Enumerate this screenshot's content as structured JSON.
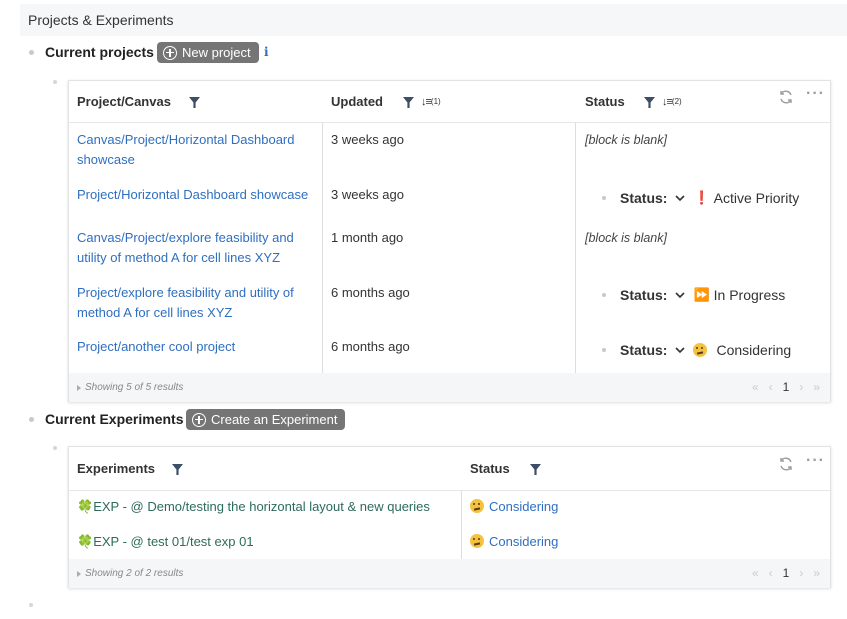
{
  "header": {
    "title": "Projects & Experiments"
  },
  "projects": {
    "title": "Current projects",
    "new_button": "New project",
    "info_icon": "i",
    "columns": [
      "Project/Canvas",
      "Updated",
      "Status"
    ],
    "sort_badges": {
      "updated": "(1)",
      "status": "(2)"
    },
    "rows": [
      {
        "project": [
          "Canvas/Project/Horizontal Dashboard",
          "showcase"
        ],
        "updated": "3 weeks ago",
        "blank": "[block is blank]"
      },
      {
        "project": [
          "Project/Horizontal Dashboard showcase"
        ],
        "updated": "3 weeks ago",
        "status_label": "Status:",
        "status_emoji": "❗",
        "status_value": "Active Priority"
      },
      {
        "project": [
          "Canvas/Project/explore feasibility and",
          "utility of method A for cell lines XYZ"
        ],
        "updated": "1 month ago",
        "blank": "[block is blank]"
      },
      {
        "project": [
          "Project/explore feasibility and utility of",
          "method A for cell lines XYZ"
        ],
        "updated": "6 months ago",
        "status_label": "Status:",
        "status_emoji": "⏩",
        "status_value": "In Progress"
      },
      {
        "project": [
          "Project/another cool project"
        ],
        "updated": "6 months ago",
        "status_label": "Status:",
        "status_emoji": "🤔",
        "status_value": "Considering"
      }
    ],
    "footer": "Showing 5 of 5 results",
    "page": "1",
    "pager": {
      "first": "«",
      "prev": "‹",
      "next": "›",
      "last": "»"
    }
  },
  "experiments": {
    "title": "Current Experiments",
    "new_button": "Create an Experiment",
    "columns": [
      "Experiments",
      "Status"
    ],
    "rows": [
      {
        "name": "EXP - @ Demo/testing the horizontal layout & new queries",
        "status": "Considering"
      },
      {
        "name": "EXP - @ test 01/test exp 01",
        "status": "Considering"
      }
    ],
    "footer": "Showing 2 of 2 results",
    "page": "1",
    "pager": {
      "first": "«",
      "prev": "‹",
      "next": "›",
      "last": "»"
    }
  },
  "icons": {
    "clover": "🍀",
    "more": "···"
  },
  "colors": {
    "link": "#2f6fc0",
    "exp_link": "#2d6b5c",
    "button": "#757575"
  }
}
